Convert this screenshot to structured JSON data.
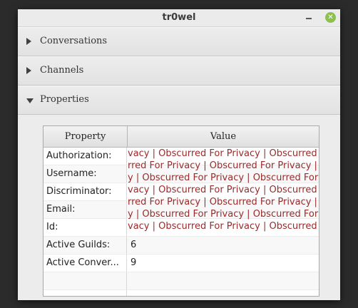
{
  "window": {
    "title": "tr0wel"
  },
  "accordion": [
    {
      "label": "Conversations",
      "expanded": false
    },
    {
      "label": "Channels",
      "expanded": false
    },
    {
      "label": "Properties",
      "expanded": true
    }
  ],
  "table": {
    "headers": {
      "property": "Property",
      "value": "Value"
    },
    "rows": [
      {
        "property": "Authorization:",
        "value": ""
      },
      {
        "property": "Username:",
        "value": ""
      },
      {
        "property": "Discriminator:",
        "value": ""
      },
      {
        "property": "Email:",
        "value": ""
      },
      {
        "property": "Id:",
        "value": ""
      },
      {
        "property": "Active Guilds:",
        "value": "6"
      },
      {
        "property": "Active Conver...",
        "value": "9"
      },
      {
        "property": "",
        "value": ""
      },
      {
        "property": "",
        "value": ""
      }
    ],
    "obscured_lines": [
      "vacy | Obscurred For Privacy | Obscurred",
      "rred For Privacy | Obscurred For Privacy |",
      "y | Obscurred For Privacy | Obscurred For",
      "vacy | Obscurred For Privacy | Obscurred For",
      "rred For Privacy | Obscurred For Privacy |",
      "y | Obscurred For Privacy | Obscurred For",
      "vacy | Obscurred For Privacy | Obscurred"
    ]
  },
  "colors": {
    "obscured_text": "#9b2a2a",
    "close_button": "#8cc152"
  },
  "icons": {
    "minimize": "minimize-icon",
    "close": "close-icon",
    "collapsed": "triangle-right-icon",
    "expanded": "triangle-down-icon"
  }
}
